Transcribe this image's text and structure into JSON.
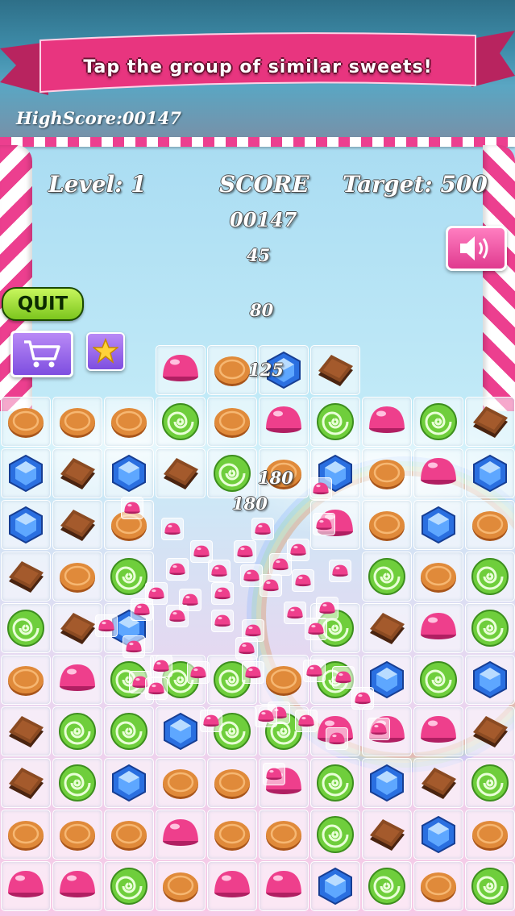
{
  "banner": {
    "text": "Tap the group of similar sweets!"
  },
  "highscore": {
    "label": "HighScore:00147"
  },
  "hud": {
    "level": "Level: 1",
    "score_label": "SCORE",
    "target": "Target: 500",
    "score_value": "00147"
  },
  "floating_points": [
    "45",
    "80",
    "125",
    "180",
    "180"
  ],
  "buttons": {
    "quit_label": "QUIT",
    "sound_icon": "speaker-icon",
    "cart_icon": "cart-icon",
    "star_icon": "star-icon"
  },
  "colors": {
    "banner": "#e8357f",
    "pole_stripe": "#ec3f8f",
    "quit": "#9ad93a",
    "shop": "#9b6cef",
    "sound": "#f05aa6"
  },
  "legend": {
    "C": "caramel",
    "P": "pink-jelly",
    "G": "green-swirl",
    "B": "blue-gem",
    "K": "chocolate"
  },
  "board": [
    [
      "",
      "",
      "",
      "P",
      "C",
      "B",
      "K",
      "",
      "",
      ""
    ],
    [
      "C",
      "C",
      "C",
      "G",
      "C",
      "P",
      "G",
      "P",
      "G",
      "K"
    ],
    [
      "B",
      "K",
      "B",
      "K",
      "G",
      "C",
      "B",
      "C",
      "P",
      "B"
    ],
    [
      "B",
      "K",
      "C",
      "",
      "",
      "",
      "P",
      "C",
      "B",
      "C"
    ],
    [
      "K",
      "C",
      "G",
      "",
      "",
      "",
      "",
      "G",
      "C",
      "G"
    ],
    [
      "G",
      "K",
      "B",
      "",
      "",
      "",
      "G",
      "K",
      "P",
      "G"
    ],
    [
      "C",
      "P",
      "G",
      "G",
      "G",
      "C",
      "G",
      "B",
      "G",
      "B"
    ],
    [
      "K",
      "G",
      "G",
      "B",
      "G",
      "G",
      "P",
      "P",
      "P",
      "K"
    ],
    [
      "K",
      "G",
      "B",
      "C",
      "C",
      "P",
      "G",
      "B",
      "K",
      "G"
    ],
    [
      "C",
      "C",
      "C",
      "P",
      "C",
      "C",
      "G",
      "K",
      "B",
      "C"
    ],
    [
      "P",
      "P",
      "G",
      "C",
      "P",
      "P",
      "B",
      "G",
      "C",
      "G"
    ]
  ]
}
